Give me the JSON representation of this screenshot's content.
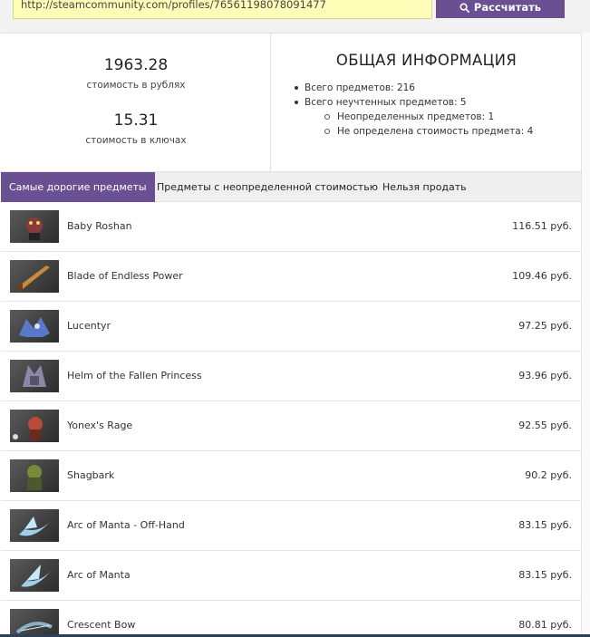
{
  "search": {
    "url_value": "http://steamcommunity.com/profiles/76561198078091477",
    "calc_label": "Рассчитать"
  },
  "summary": {
    "rub_value": "1963.28",
    "rub_label": "стоимость в рублях",
    "keys_value": "15.31",
    "keys_label": "стоимость в ключах"
  },
  "info": {
    "title": "ОБЩАЯ ИНФОРМАЦИЯ",
    "total": "Всего предметов: 216",
    "unaccounted": "Всего неучтенных предметов: 5",
    "undefined_items": "Неопределенных предметов: 1",
    "undefined_price": "Не определена стоимость предмета: 4"
  },
  "tabs": [
    {
      "label": "Самые дорогие предметы",
      "active": true
    },
    {
      "label": "Предметы с неопределенной стоимостью",
      "active": false
    },
    {
      "label": "Нельзя продать",
      "active": false
    }
  ],
  "items": [
    {
      "name": "Baby Roshan",
      "price": "116.51 руб.",
      "icon": "baby-roshan-icon",
      "color": "#8a3a3a"
    },
    {
      "name": "Blade of Endless Power",
      "price": "109.46 руб.",
      "icon": "blade-icon",
      "color": "#c9893a"
    },
    {
      "name": "Lucentyr",
      "price": "97.25 руб.",
      "icon": "lucentyr-icon",
      "color": "#5a78c8"
    },
    {
      "name": "Helm of the Fallen Princess",
      "price": "93.96 руб.",
      "icon": "helm-icon",
      "color": "#8a88a6"
    },
    {
      "name": "Yonex's Rage",
      "price": "92.55 руб.",
      "icon": "yonex-icon",
      "color": "#b84a3a"
    },
    {
      "name": "Shagbark",
      "price": "90.2 руб.",
      "icon": "shagbark-icon",
      "color": "#7a8a3a"
    },
    {
      "name": "Arc of Manta - Off-Hand",
      "price": "83.15 руб.",
      "icon": "arc-offhand-icon",
      "color": "#9ed0ee"
    },
    {
      "name": "Arc of Manta",
      "price": "83.15 руб.",
      "icon": "arc-icon",
      "color": "#9ed0ee"
    },
    {
      "name": "Crescent Bow",
      "price": "80.81 руб.",
      "icon": "crescent-bow-icon",
      "color": "#8ab0c8"
    }
  ],
  "colors": {
    "accent": "#6a4f93",
    "input_bg": "#fffeb8"
  }
}
